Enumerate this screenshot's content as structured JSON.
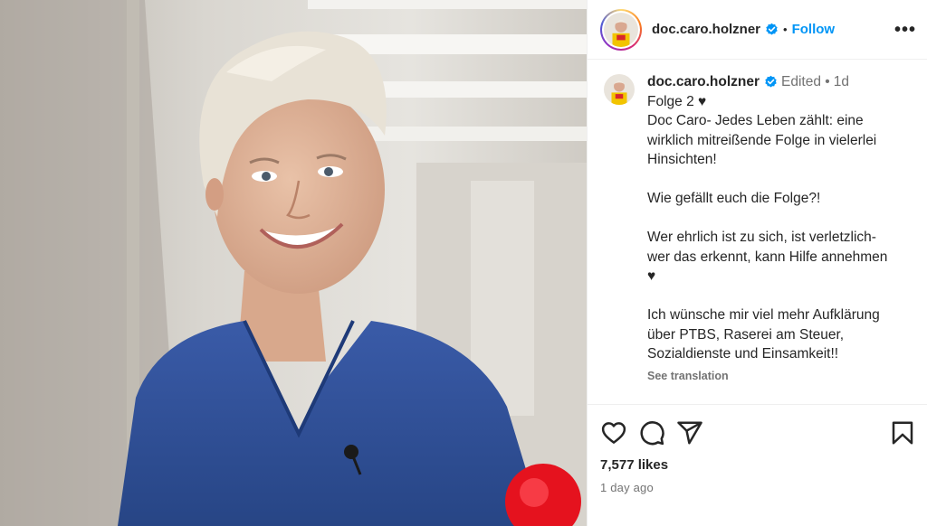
{
  "post": {
    "username": "doc.caro.holzner",
    "follow_label": "Follow",
    "dot": "•",
    "more_label": "•••"
  },
  "caption": {
    "username": "doc.caro.holzner",
    "edited_label": "Edited •",
    "time": "1d",
    "lines": [
      "Folge 2 ♥",
      "Doc Caro- Jedes Leben zählt: eine",
      "wirklich mitreißende Folge in vielerlei",
      "Hinsichten!",
      "",
      "Wie gefällt euch die Folge?!",
      "",
      "Wer ehrlich ist zu sich, ist verletzlich-",
      "wer das erkennt, kann Hilfe annehmen",
      "♥",
      "",
      "Ich wünsche mir viel mehr Aufklärung",
      "über PTBS, Raserei am Steuer,",
      "Sozialdienste und Einsamkeit!!"
    ],
    "see_translation": "See translation"
  },
  "actions": {
    "icons": [
      "heart-icon",
      "comment-icon",
      "share-icon",
      "bookmark-icon"
    ],
    "likes": "7,577 likes",
    "posted": "1 day ago"
  },
  "colors": {
    "accent": "#0095f6",
    "verified": "#0095f6",
    "muted": "#737373",
    "scrubs": "#2f4f9a"
  }
}
